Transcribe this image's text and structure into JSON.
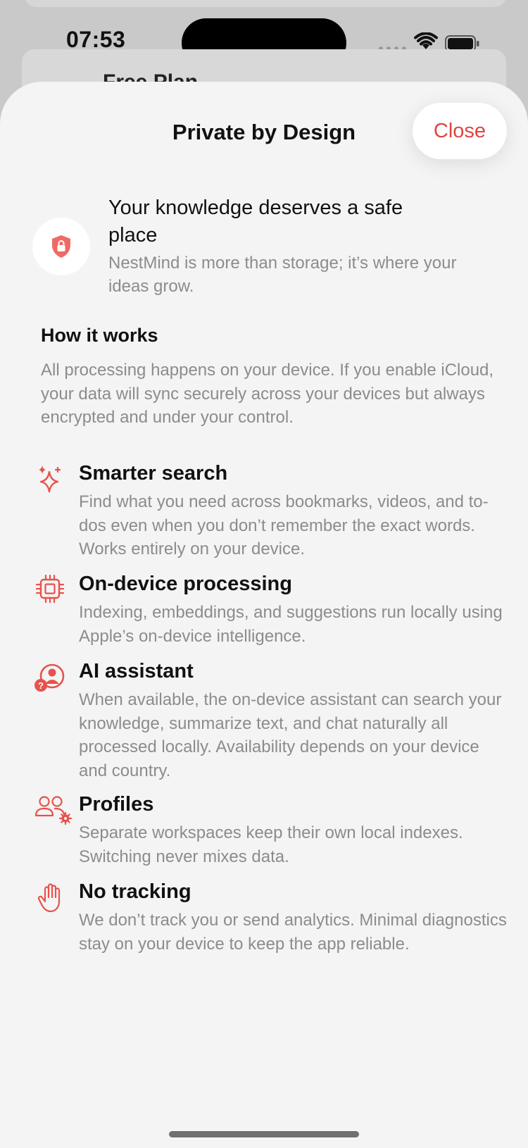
{
  "status_bar": {
    "time": "07:53"
  },
  "background": {
    "card_title": "Free Plan"
  },
  "sheet": {
    "title": "Private by Design",
    "close_label": "Close",
    "accent_color": "#e0453f"
  },
  "hero": {
    "icon": "shield-lock-icon",
    "title": "Your knowledge deserves a safe place",
    "subtitle": "NestMind is more than storage; it’s where your ideas grow."
  },
  "how_it_works": {
    "title": "How it works",
    "body": "All processing happens on your device. If you enable iCloud, your data will sync securely across your devices but always encrypted and under your control."
  },
  "features": [
    {
      "icon": "sparkles-icon",
      "title": "Smarter search",
      "description": "Find what you need across bookmarks, videos, and to-dos even when you don’t remember the exact words. Works entirely on your device."
    },
    {
      "icon": "cpu-icon",
      "title": "On-device processing",
      "description": "Indexing, embeddings, and suggestions run locally using Apple’s on-device intelligence."
    },
    {
      "icon": "person-question-icon",
      "title": "AI assistant",
      "description": "When available, the on-device assistant can search your knowledge, summarize text, and chat naturally all processed locally. Availability depends on your device and country."
    },
    {
      "icon": "people-gear-icon",
      "title": "Profiles",
      "description": "Separate workspaces keep their own local indexes. Switching never mixes data."
    },
    {
      "icon": "hand-raised-icon",
      "title": "No tracking",
      "description": "We don’t track you or send analytics. Minimal diagnostics stay on your device to keep the app reliable."
    }
  ]
}
